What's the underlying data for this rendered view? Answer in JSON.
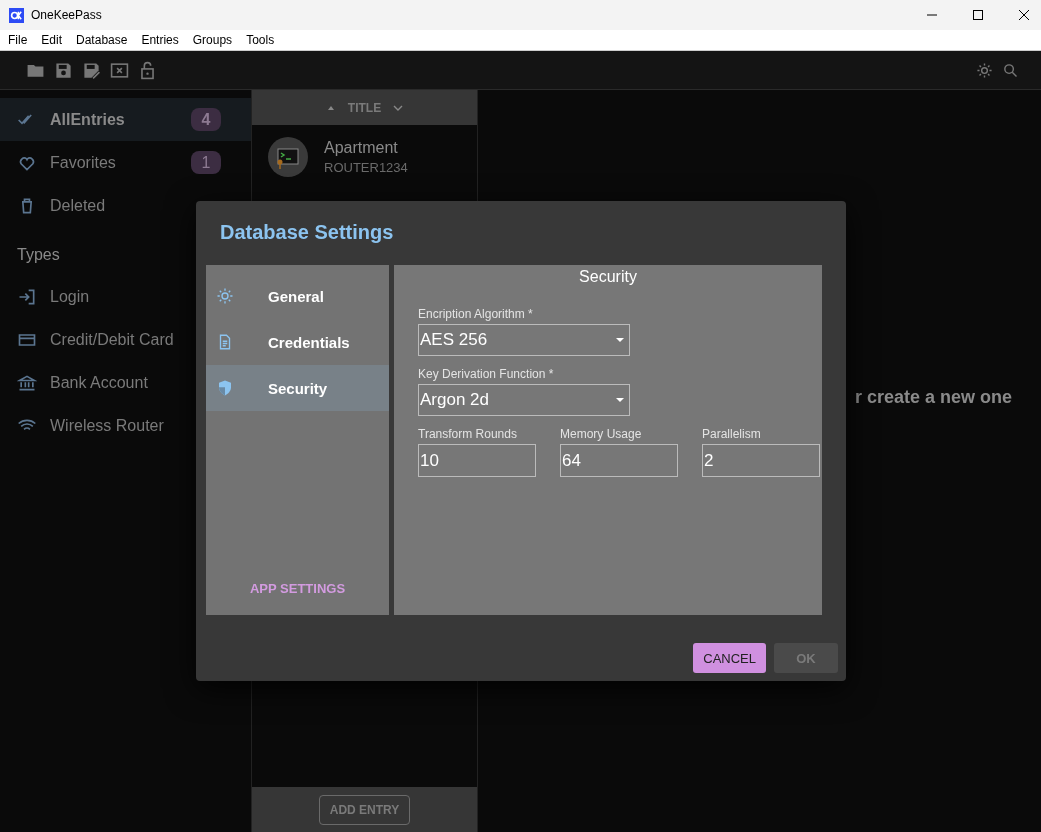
{
  "window": {
    "title": "OneKeePass"
  },
  "menu": [
    "File",
    "Edit",
    "Database",
    "Entries",
    "Groups",
    "Tools"
  ],
  "sidebar": {
    "items": [
      {
        "label": "AllEntries",
        "count": "4",
        "selected": true
      },
      {
        "label": "Favorites",
        "count": "1",
        "selected": false
      },
      {
        "label": "Deleted",
        "selected": false
      }
    ],
    "section": "Types",
    "types": [
      {
        "label": "Login"
      },
      {
        "label": "Credit/Debit Card"
      },
      {
        "label": "Bank Account"
      },
      {
        "label": "Wireless Router"
      }
    ]
  },
  "entry_list": {
    "sort_label": "TITLE",
    "entries": [
      {
        "title": "Apartment",
        "subtitle": "ROUTER1234"
      }
    ],
    "add_button": "ADD ENTRY"
  },
  "main": {
    "message": "r create a new one"
  },
  "dialog": {
    "title": "Database Settings",
    "nav": [
      {
        "label": "General",
        "selected": false
      },
      {
        "label": "Credentials",
        "selected": false
      },
      {
        "label": "Security",
        "selected": true
      }
    ],
    "app_settings": "APP SETTINGS",
    "section_title": "Security",
    "selects": [
      {
        "label": "Encription Algorithm *",
        "value": "AES 256"
      },
      {
        "label": "Key Derivation Function *",
        "value": "Argon 2d"
      }
    ],
    "fields": [
      {
        "label": "Transform Rounds",
        "value": "10"
      },
      {
        "label": "Memory Usage",
        "value": "64"
      },
      {
        "label": "Parallelism",
        "value": "2"
      }
    ],
    "buttons": [
      {
        "label": "CANCEL",
        "kind": "primary"
      },
      {
        "label": "OK",
        "kind": "disabled"
      }
    ]
  }
}
